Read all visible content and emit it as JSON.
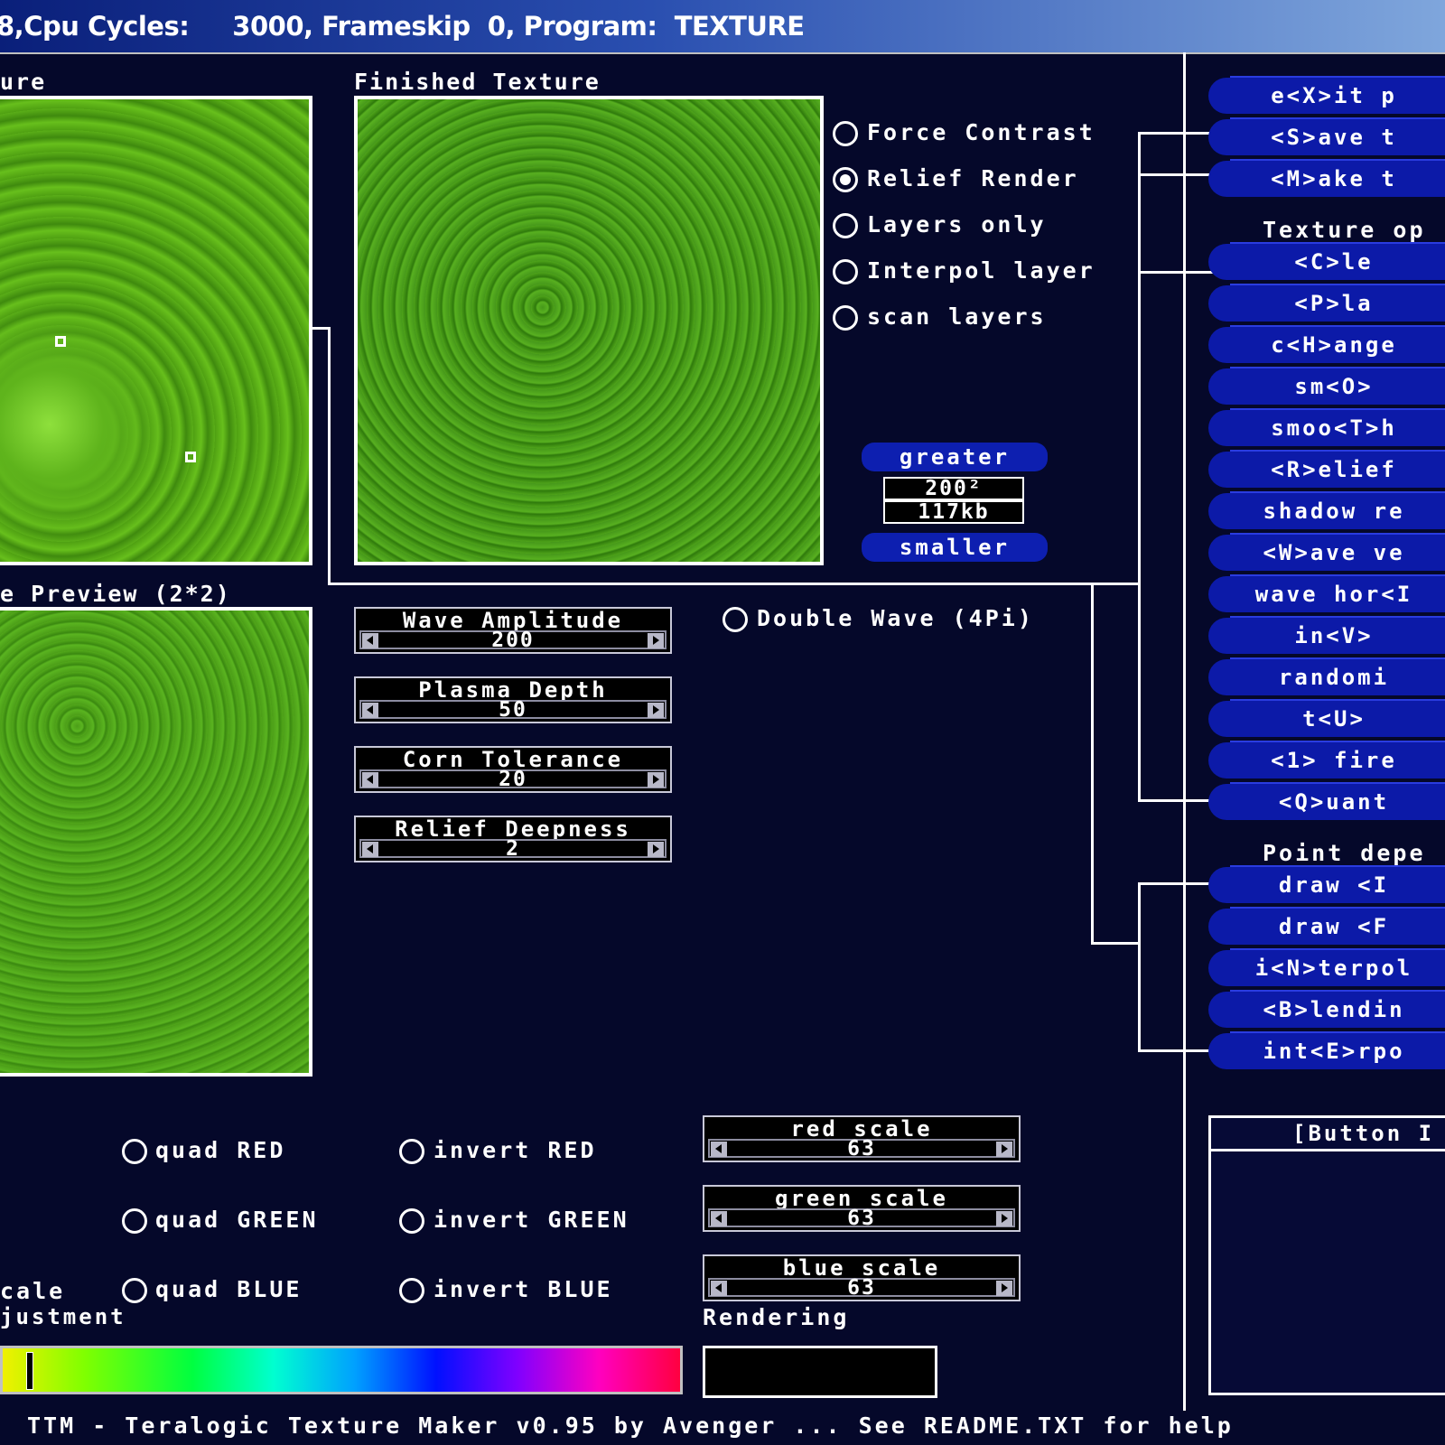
{
  "window": {
    "title": "8,Cpu Cycles:     3000, Frameskip  0, Program:  TEXTURE"
  },
  "panels": {
    "texture_label": "ure",
    "finished_label": "Finished Texture",
    "preview_label": "e Preview (2*2)"
  },
  "render_modes": [
    {
      "label": "Force Contrast",
      "checked": false
    },
    {
      "label": "Relief Render",
      "checked": true
    },
    {
      "label": "Layers only",
      "checked": false
    },
    {
      "label": "Interpol layer",
      "checked": false
    },
    {
      "label": "scan layers",
      "checked": false
    }
  ],
  "size_control": {
    "greater": "greater",
    "size": "200²",
    "memory": "117kb",
    "smaller": "smaller"
  },
  "sliders": [
    {
      "title": "Wave Amplitude",
      "value": "200"
    },
    {
      "title": "Plasma Depth",
      "value": "50"
    },
    {
      "title": "Corn Tolerance",
      "value": "20"
    },
    {
      "title": "Relief Deepness",
      "value": "2"
    }
  ],
  "double_wave": {
    "label": "Double Wave (4Pi)",
    "checked": false
  },
  "color_options": {
    "quad": [
      "quad RED",
      "quad GREEN",
      "quad BLUE"
    ],
    "invert": [
      "invert RED",
      "invert GREEN",
      "invert BLUE"
    ],
    "scales": [
      {
        "title": "red scale",
        "value": "63"
      },
      {
        "title": "green scale",
        "value": "63"
      },
      {
        "title": "blue scale",
        "value": "63"
      }
    ],
    "scale_label_partial": "cale",
    "adjustment_label": "justment"
  },
  "rendering": {
    "label": "Rendering"
  },
  "commands_top": [
    "e<X>it p",
    "<S>ave t",
    "<M>ake t"
  ],
  "texture_ops_heading": "Texture op",
  "commands_texture": [
    "<C>le",
    "<P>la",
    "c<H>ange",
    "sm<O>",
    "smoo<T>h",
    "<R>elief",
    "shadow re",
    "<W>ave ve",
    "wave hor<I",
    "in<V>",
    "randomi",
    "t<U>",
    "<1> fire",
    "<Q>uant"
  ],
  "point_dep_heading": "Point depe",
  "commands_point": [
    "draw <I",
    "draw <F",
    "i<N>terpol",
    "<B>lendin",
    "int<E>rpo"
  ],
  "button_panel": {
    "title": "[Button I"
  },
  "status_bar": "TTM - Teralogic Texture Maker v0.95 by Avenger ... See README.TXT for help",
  "colors": {
    "panel_bg": "#05082a",
    "button_blue": "#0c1aa8",
    "texture_green": "#4a9c16"
  }
}
